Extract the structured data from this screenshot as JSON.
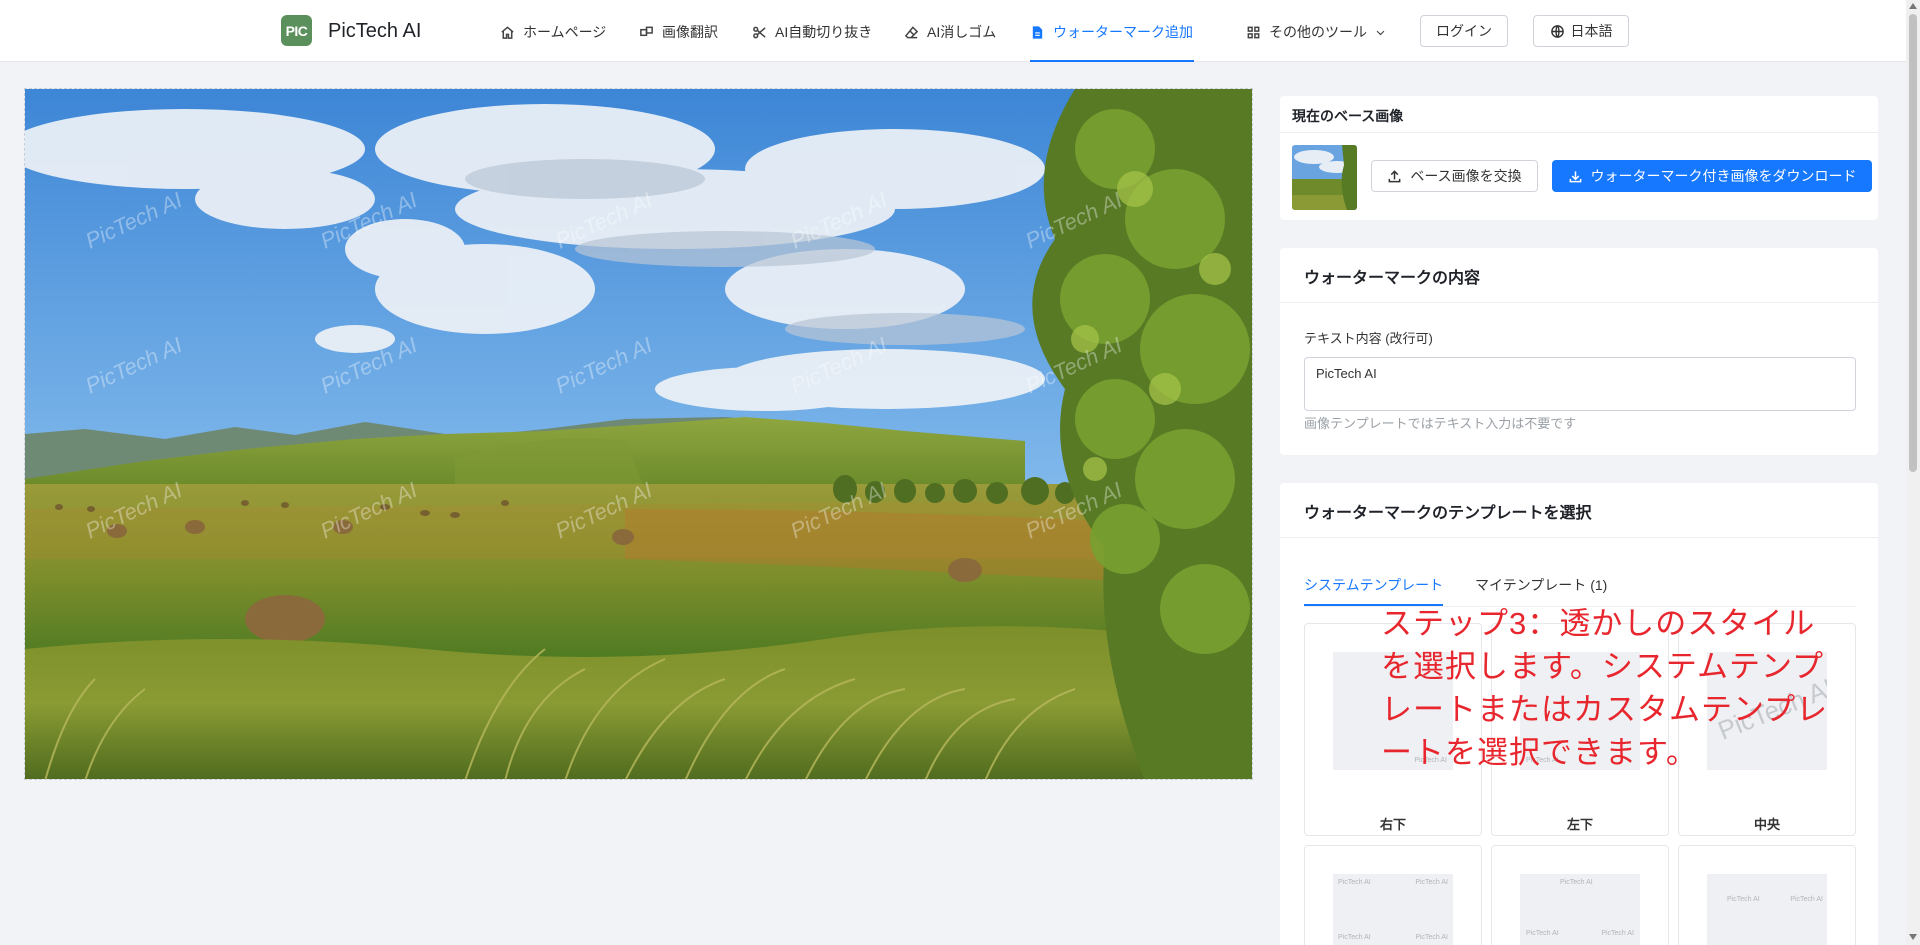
{
  "header": {
    "logo_text": "PIC",
    "brand": "PicTech AI",
    "nav": [
      {
        "label": "ホームページ",
        "icon": "home-icon"
      },
      {
        "label": "画像翻訳",
        "icon": "translate-icon"
      },
      {
        "label": "AI自動切り抜き",
        "icon": "scissors-icon"
      },
      {
        "label": "AI消しゴム",
        "icon": "eraser-icon"
      },
      {
        "label": "ウォーターマーク追加",
        "icon": "document-icon",
        "active": true
      },
      {
        "label": "その他のツール",
        "icon": "grid-icon"
      }
    ],
    "login": "ログイン",
    "language": "日本語"
  },
  "canvas": {
    "watermark_text": "PicTech AI"
  },
  "base_image_panel": {
    "title": "現在のベース画像",
    "replace_button": "ベース画像を交換",
    "download_button": "ウォーターマーク付き画像をダウンロード"
  },
  "content_panel": {
    "title": "ウォーターマークの内容",
    "field_label": "テキスト内容 (改行可)",
    "field_value": "PicTech AI",
    "hint": "画像テンプレートではテキスト入力は不要です"
  },
  "template_panel": {
    "title": "ウォーターマークのテンプレートを選択",
    "tabs": [
      {
        "label": "システムテンプレート",
        "active": true
      },
      {
        "label": "マイテンプレート (1)"
      }
    ],
    "templates": [
      {
        "label": "右下"
      },
      {
        "label": "左下"
      },
      {
        "label": "中央"
      }
    ],
    "preview_text": "PicTech AI"
  },
  "annotation": {
    "text": "ステップ3：透かしのスタイルを選択します。システムテンプレートまたはカスタムテンプレートを選択できます。"
  },
  "colors": {
    "accent": "#1677ff",
    "annotation": "#e8262e",
    "logo": "#5b8f5c"
  }
}
